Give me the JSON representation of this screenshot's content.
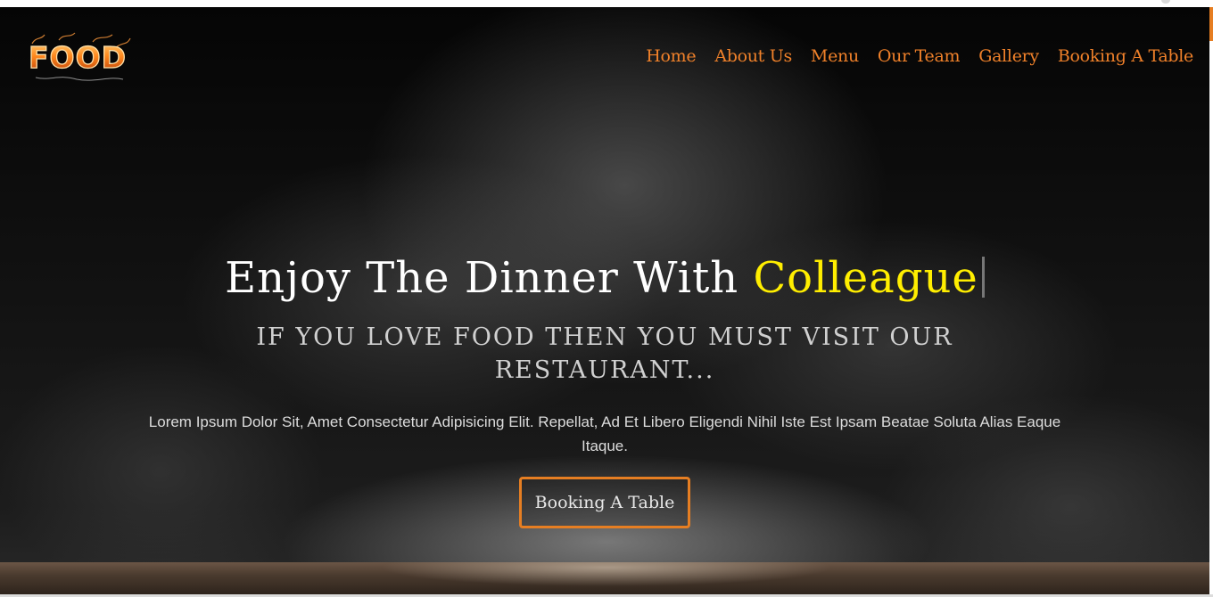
{
  "header": {
    "logo_text": "FOOD",
    "nav": [
      {
        "label": "Home"
      },
      {
        "label": "About Us"
      },
      {
        "label": "Menu"
      },
      {
        "label": "Our Team"
      },
      {
        "label": "Gallery"
      },
      {
        "label": "Booking A Table"
      }
    ]
  },
  "hero": {
    "headline_prefix": "Enjoy The Dinner With",
    "headline_typed": "Colleague",
    "subheading": "IF YOU LOVE FOOD THEN YOU MUST VISIT OUR RESTAURANT...",
    "paragraph": "Lorem Ipsum Dolor Sit, Amet Consectetur Adipisicing Elit. Repellat, Ad Et Libero Eligendi Nihil Iste Est Ipsam Beatae Soluta Alias Eaque Itaque.",
    "cta_label": "Booking A Table"
  },
  "colors": {
    "accent": "#e67e22",
    "nav_text": "#f0812a",
    "highlight": "#ffee00",
    "background": "#0b0b0b"
  },
  "icons": {
    "logo": "food-logo-icon",
    "cursor": "text-cursor-icon"
  }
}
